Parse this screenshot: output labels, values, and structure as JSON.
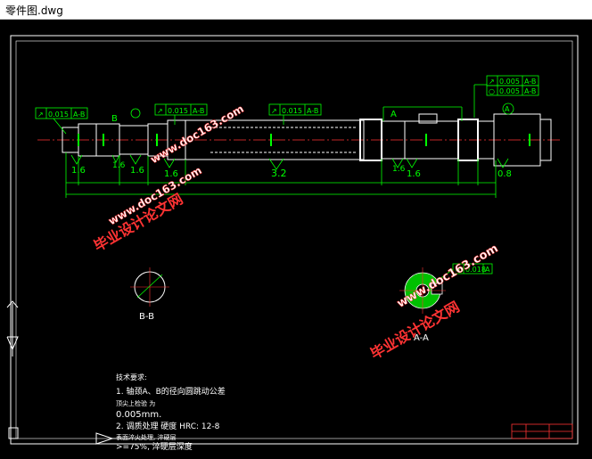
{
  "window": {
    "title": "零件图.dwg"
  },
  "colors": {
    "background": "#000000",
    "outline": "#ffffff",
    "dimension": "#00ff00",
    "centerline": "#ff0000",
    "watermark": "#ff3333",
    "watermark_url": "#ffffff"
  },
  "drawing": {
    "tolerances": {
      "t1": {
        "sym": "↗",
        "value": "0.015",
        "ref": "A-B"
      },
      "t2": {
        "sym": "↗",
        "value": "0.015",
        "ref": "A-B"
      },
      "t3": {
        "sym": "↗",
        "value": "0.015",
        "ref": "A-B"
      },
      "t4": {
        "sym": "↗",
        "value": "0.005",
        "ref": "A-B"
      },
      "t5": {
        "sym": "○",
        "value": "0.005",
        "ref": "A-B"
      },
      "t6": {
        "sym": "≡",
        "value": "0.018",
        "ref": "A"
      }
    },
    "datums": {
      "a": "A",
      "b": "B",
      "top_a": "A",
      "section_a": "A"
    },
    "roughness": [
      "1.6",
      "1.6",
      "1.6",
      "1.6",
      "3.2",
      "1.6",
      "1.6",
      "0.8"
    ],
    "section_labels": {
      "bb": "B-B",
      "aa": "A-A"
    },
    "notes": {
      "heading": "技术要求:",
      "line1": "1. 轴颈A、B的径向圆跳动公差",
      "line1b": "顶尖上检验 为",
      "line2": "0.005mm.",
      "line3": "2. 调质处理 硬度 HRC: 12-8",
      "line4": "表面淬火处理, 淬硬层",
      "line5": ">=75%, 淬硬层深度"
    },
    "watermarks": {
      "left_url": "www.doc163.com",
      "left_cn": "毕业设计论文网",
      "right_url": "www.doc163.com",
      "right_cn": "毕业设计论文网",
      "center_url": "www.doc163.com"
    }
  }
}
